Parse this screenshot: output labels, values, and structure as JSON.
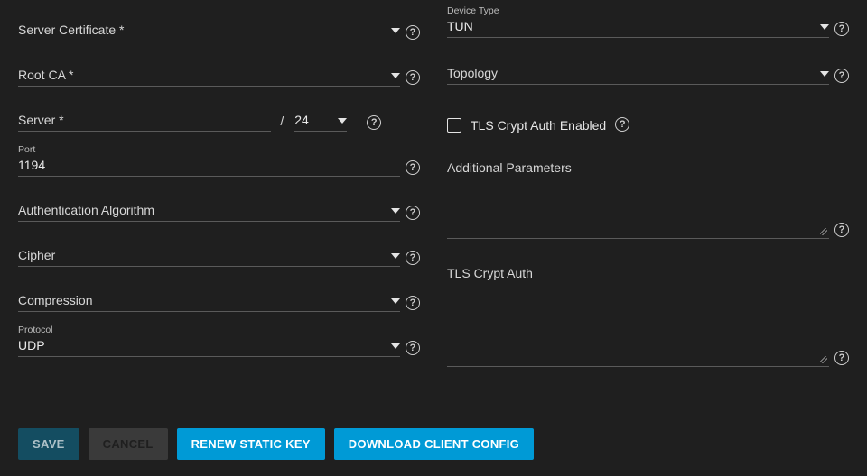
{
  "left": {
    "server_cert": {
      "label": "Server Certificate *"
    },
    "root_ca": {
      "label": "Root CA *"
    },
    "server": {
      "label": "Server *",
      "mask": "24"
    },
    "port": {
      "floatLabel": "Port",
      "value": "1194"
    },
    "auth_algo": {
      "label": "Authentication Algorithm"
    },
    "cipher": {
      "label": "Cipher"
    },
    "compression": {
      "label": "Compression"
    },
    "protocol": {
      "floatLabel": "Protocol",
      "value": "UDP"
    }
  },
  "right": {
    "device_type": {
      "floatLabel": "Device Type",
      "value": "TUN"
    },
    "topology": {
      "label": "Topology"
    },
    "tls_checkbox": {
      "label": "TLS Crypt Auth Enabled"
    },
    "additional_params": {
      "label": "Additional Parameters"
    },
    "tls_crypt_auth": {
      "label": "TLS Crypt Auth"
    }
  },
  "footer": {
    "save": "SAVE",
    "cancel": "CANCEL",
    "renew": "RENEW STATIC KEY",
    "download": "DOWNLOAD CLIENT CONFIG"
  }
}
